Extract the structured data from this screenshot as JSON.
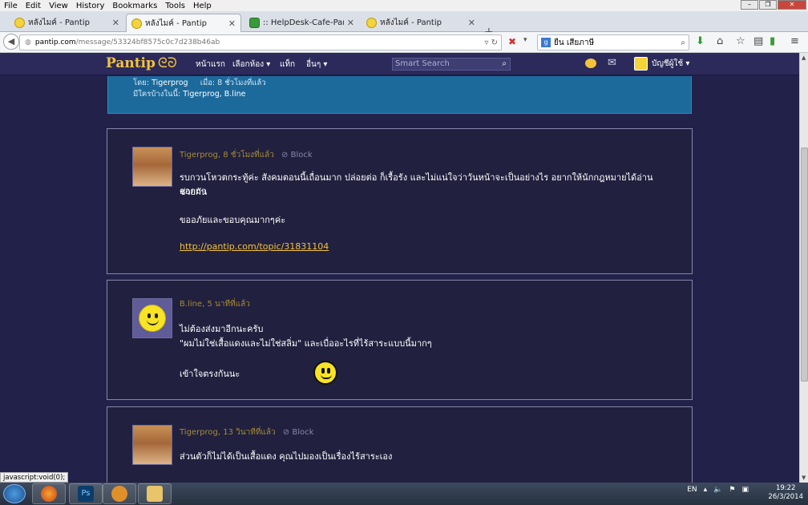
{
  "menubar": {
    "items": [
      "File",
      "Edit",
      "View",
      "History",
      "Bookmarks",
      "Tools",
      "Help"
    ]
  },
  "tabs": [
    {
      "title": "หลังไมค์ - Pantip",
      "icon": "smiley-favicon-icon"
    },
    {
      "title": "หลังไมค์ - Pantip",
      "icon": "smiley-favicon-icon",
      "active": true
    },
    {
      "title": ":: HelpDesk-Cafe-Pantip.co...",
      "icon": "cactus-favicon-icon"
    },
    {
      "title": "หลังไมค์ - Pantip",
      "icon": "smiley-favicon-icon"
    }
  ],
  "urlbar": {
    "host": "pantip.com",
    "path": "/message/53324bf8575c0c7d238b46ab"
  },
  "search": {
    "value": "ยืน เสียภาษี"
  },
  "site": {
    "logo": "Pantip",
    "logo_glyph": "ᘓᘐ",
    "nav": [
      "หน้าแรก",
      "เลือกห้อง ▾",
      "แท็ก",
      "อื่นๆ ▾"
    ],
    "search_placeholder": "Smart Search",
    "account": "บัญชีผู้ใช้ ▾"
  },
  "info": {
    "line1": {
      "by_label": "โดย:",
      "by": "Tigerprog",
      "when_label": "เมื่อ:",
      "when": "8 ชั่วโมงที่แล้ว"
    },
    "line2": {
      "label": "มีใครบ้างในนี้:",
      "members": "Tigerprog, B.line"
    }
  },
  "posts": [
    {
      "author": "Tigerprog",
      "time": "8 ชั่วโมงที่แล้ว",
      "block_label": "Block",
      "lines": [
        "รบกวนโหวตกระทู้ค่ะ สังคมตอนนี้เถื่อนมาก ปล่อยต่อ ก็เรื้อรัง และไม่แน่ใจว่าวันหน้าจะเป็นอย่างไร อยากให้นักกฎหมายได้อ่าน ออกมา",
        "ช่วยกัน",
        "ขออภัยและขอบคุณมากๆค่ะ"
      ],
      "link": "http://pantip.com/topic/31831104"
    },
    {
      "author": "B.line",
      "time": "5 นาทีที่แล้ว",
      "lines": [
        "ไม่ต้องส่งมาอีกนะครับ",
        "\"ผมไม่ใช่เสื้อแดงและไม่ใช่สลิ่ม\" และเบื่ออะไรที่ไร้สาระแบบนี้มากๆ",
        "เข้าใจตรงกันนะ"
      ]
    },
    {
      "author": "Tigerprog",
      "time": "13 วินาทีที่แล้ว",
      "block_label": "Block",
      "lines": [
        "ส่วนตัวก็ไม่ได้เป็นเสื้อแดง คุณไปมองเป็นเรื่องไร้สาระเอง"
      ]
    }
  ],
  "statusbar": "javascript:void(0);",
  "taskbar": {
    "lang": "EN",
    "time": "19:22",
    "date": "26/3/2014"
  }
}
